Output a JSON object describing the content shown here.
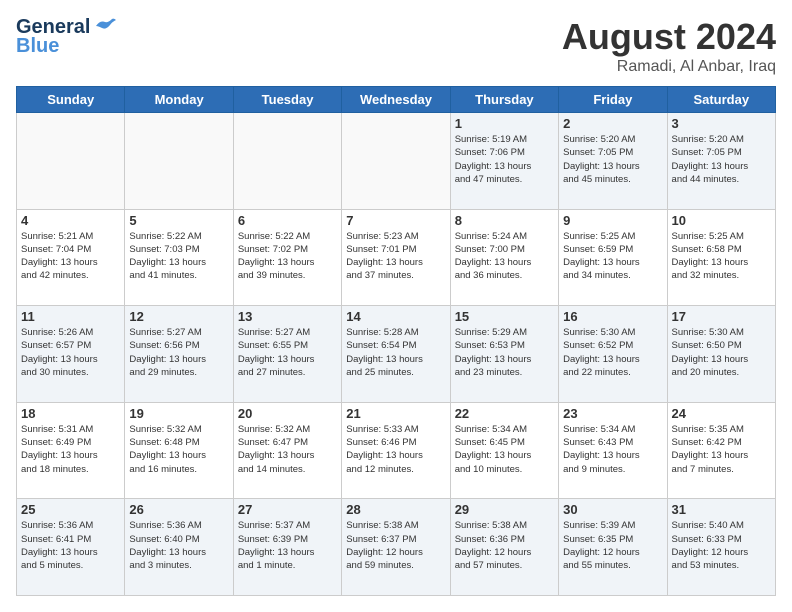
{
  "header": {
    "logo_line1": "General",
    "logo_line2": "Blue",
    "month": "August 2024",
    "location": "Ramadi, Al Anbar, Iraq"
  },
  "weekdays": [
    "Sunday",
    "Monday",
    "Tuesday",
    "Wednesday",
    "Thursday",
    "Friday",
    "Saturday"
  ],
  "weeks": [
    [
      {
        "day": "",
        "info": ""
      },
      {
        "day": "",
        "info": ""
      },
      {
        "day": "",
        "info": ""
      },
      {
        "day": "",
        "info": ""
      },
      {
        "day": "1",
        "info": "Sunrise: 5:19 AM\nSunset: 7:06 PM\nDaylight: 13 hours\nand 47 minutes."
      },
      {
        "day": "2",
        "info": "Sunrise: 5:20 AM\nSunset: 7:05 PM\nDaylight: 13 hours\nand 45 minutes."
      },
      {
        "day": "3",
        "info": "Sunrise: 5:20 AM\nSunset: 7:05 PM\nDaylight: 13 hours\nand 44 minutes."
      }
    ],
    [
      {
        "day": "4",
        "info": "Sunrise: 5:21 AM\nSunset: 7:04 PM\nDaylight: 13 hours\nand 42 minutes."
      },
      {
        "day": "5",
        "info": "Sunrise: 5:22 AM\nSunset: 7:03 PM\nDaylight: 13 hours\nand 41 minutes."
      },
      {
        "day": "6",
        "info": "Sunrise: 5:22 AM\nSunset: 7:02 PM\nDaylight: 13 hours\nand 39 minutes."
      },
      {
        "day": "7",
        "info": "Sunrise: 5:23 AM\nSunset: 7:01 PM\nDaylight: 13 hours\nand 37 minutes."
      },
      {
        "day": "8",
        "info": "Sunrise: 5:24 AM\nSunset: 7:00 PM\nDaylight: 13 hours\nand 36 minutes."
      },
      {
        "day": "9",
        "info": "Sunrise: 5:25 AM\nSunset: 6:59 PM\nDaylight: 13 hours\nand 34 minutes."
      },
      {
        "day": "10",
        "info": "Sunrise: 5:25 AM\nSunset: 6:58 PM\nDaylight: 13 hours\nand 32 minutes."
      }
    ],
    [
      {
        "day": "11",
        "info": "Sunrise: 5:26 AM\nSunset: 6:57 PM\nDaylight: 13 hours\nand 30 minutes."
      },
      {
        "day": "12",
        "info": "Sunrise: 5:27 AM\nSunset: 6:56 PM\nDaylight: 13 hours\nand 29 minutes."
      },
      {
        "day": "13",
        "info": "Sunrise: 5:27 AM\nSunset: 6:55 PM\nDaylight: 13 hours\nand 27 minutes."
      },
      {
        "day": "14",
        "info": "Sunrise: 5:28 AM\nSunset: 6:54 PM\nDaylight: 13 hours\nand 25 minutes."
      },
      {
        "day": "15",
        "info": "Sunrise: 5:29 AM\nSunset: 6:53 PM\nDaylight: 13 hours\nand 23 minutes."
      },
      {
        "day": "16",
        "info": "Sunrise: 5:30 AM\nSunset: 6:52 PM\nDaylight: 13 hours\nand 22 minutes."
      },
      {
        "day": "17",
        "info": "Sunrise: 5:30 AM\nSunset: 6:50 PM\nDaylight: 13 hours\nand 20 minutes."
      }
    ],
    [
      {
        "day": "18",
        "info": "Sunrise: 5:31 AM\nSunset: 6:49 PM\nDaylight: 13 hours\nand 18 minutes."
      },
      {
        "day": "19",
        "info": "Sunrise: 5:32 AM\nSunset: 6:48 PM\nDaylight: 13 hours\nand 16 minutes."
      },
      {
        "day": "20",
        "info": "Sunrise: 5:32 AM\nSunset: 6:47 PM\nDaylight: 13 hours\nand 14 minutes."
      },
      {
        "day": "21",
        "info": "Sunrise: 5:33 AM\nSunset: 6:46 PM\nDaylight: 13 hours\nand 12 minutes."
      },
      {
        "day": "22",
        "info": "Sunrise: 5:34 AM\nSunset: 6:45 PM\nDaylight: 13 hours\nand 10 minutes."
      },
      {
        "day": "23",
        "info": "Sunrise: 5:34 AM\nSunset: 6:43 PM\nDaylight: 13 hours\nand 9 minutes."
      },
      {
        "day": "24",
        "info": "Sunrise: 5:35 AM\nSunset: 6:42 PM\nDaylight: 13 hours\nand 7 minutes."
      }
    ],
    [
      {
        "day": "25",
        "info": "Sunrise: 5:36 AM\nSunset: 6:41 PM\nDaylight: 13 hours\nand 5 minutes."
      },
      {
        "day": "26",
        "info": "Sunrise: 5:36 AM\nSunset: 6:40 PM\nDaylight: 13 hours\nand 3 minutes."
      },
      {
        "day": "27",
        "info": "Sunrise: 5:37 AM\nSunset: 6:39 PM\nDaylight: 13 hours\nand 1 minute."
      },
      {
        "day": "28",
        "info": "Sunrise: 5:38 AM\nSunset: 6:37 PM\nDaylight: 12 hours\nand 59 minutes."
      },
      {
        "day": "29",
        "info": "Sunrise: 5:38 AM\nSunset: 6:36 PM\nDaylight: 12 hours\nand 57 minutes."
      },
      {
        "day": "30",
        "info": "Sunrise: 5:39 AM\nSunset: 6:35 PM\nDaylight: 12 hours\nand 55 minutes."
      },
      {
        "day": "31",
        "info": "Sunrise: 5:40 AM\nSunset: 6:33 PM\nDaylight: 12 hours\nand 53 minutes."
      }
    ]
  ]
}
